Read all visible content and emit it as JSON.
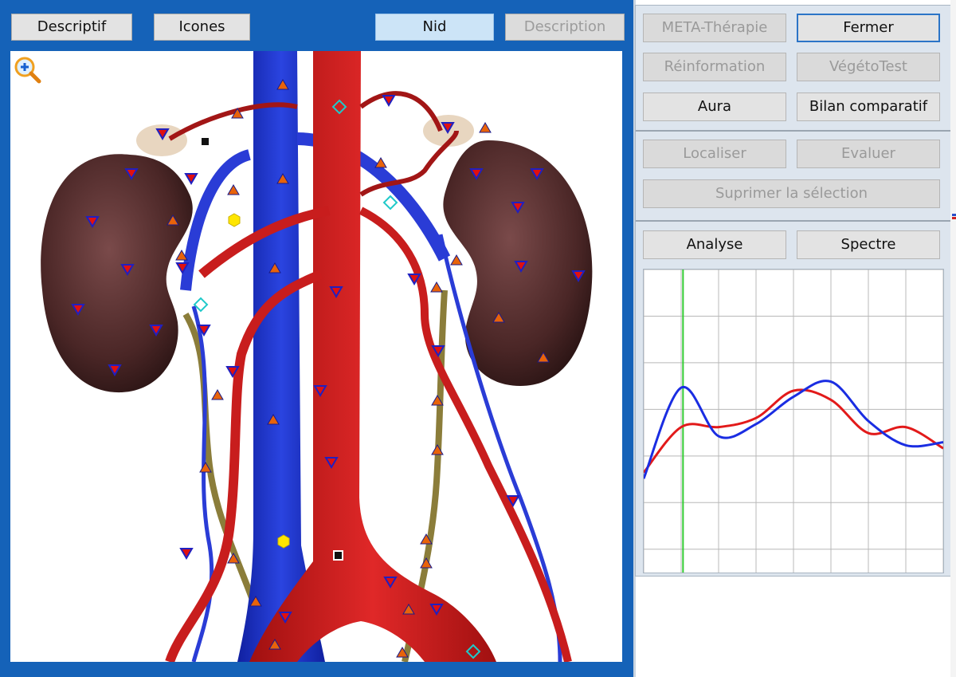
{
  "toolbar": {
    "descriptif": "Descriptif",
    "icones": "Icones",
    "nid": "Nid",
    "description": "Description"
  },
  "canvas": {
    "zoom_icon": "zoom-in-icon"
  },
  "panel": {
    "meta_therapie": "META-Thérapie",
    "fermer": "Fermer",
    "reinformation": "Réinformation",
    "vegetotest": "VégétoTest",
    "aura": "Aura",
    "bilan_comparatif": "Bilan comparatif",
    "localiser": "Localiser",
    "evaluer": "Evaluer",
    "supprimer": "Suprimer la sélection",
    "analyse": "Analyse",
    "spectre": "Spectre"
  },
  "colors": {
    "frame": "#1562b8",
    "panel_bg": "#dde5ee",
    "button_bg": "#e3e3e3",
    "active_button": "#cce4f7",
    "series_red": "#e21a1a",
    "series_blue": "#1a2de2",
    "marker_green": "#33cc33"
  },
  "chart_data": {
    "type": "line",
    "x": [
      0,
      1,
      2,
      3,
      4,
      5,
      6,
      7,
      8
    ],
    "xlim": [
      0,
      8
    ],
    "ylim": [
      0,
      10
    ],
    "grid": true,
    "marker_x": 1.05,
    "series": [
      {
        "color": "#e21a1a",
        "values": [
          3.3,
          4.8,
          4.8,
          5.1,
          6.0,
          5.7,
          4.6,
          4.8,
          4.1
        ]
      },
      {
        "color": "#1a2de2",
        "values": [
          3.1,
          6.1,
          4.5,
          4.9,
          5.8,
          6.3,
          5.0,
          4.2,
          4.3
        ]
      }
    ]
  }
}
